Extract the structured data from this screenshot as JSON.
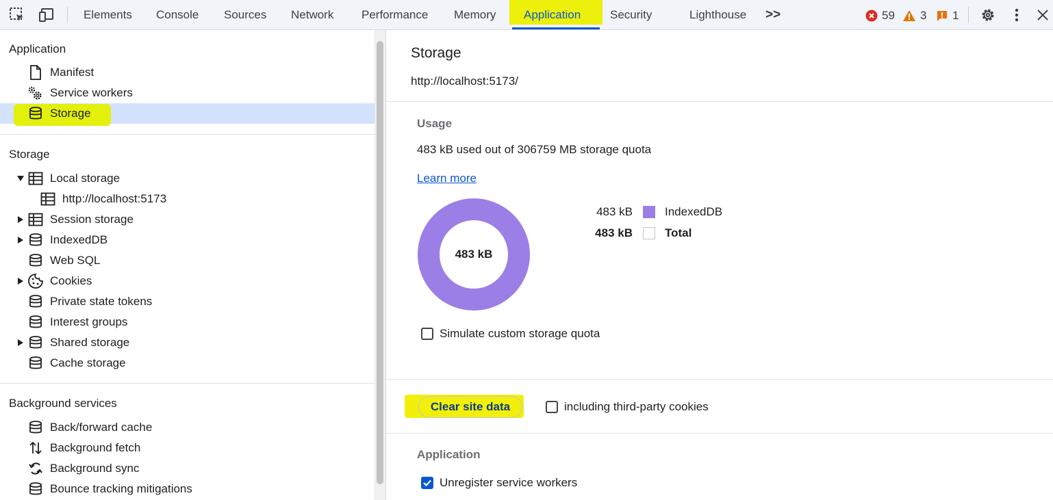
{
  "toolbar": {
    "tabs": [
      "Elements",
      "Console",
      "Sources",
      "Network",
      "Performance",
      "Memory",
      "Application",
      "Security",
      "Lighthouse"
    ],
    "active_tab": "Application",
    "more_tabs": ">>",
    "errors_count": "59",
    "warnings_count": "3",
    "issues_count": "1",
    "colors": {
      "active": "#0b57d0",
      "error": "#d93025",
      "warning": "#e37400",
      "issue": "#e8710a"
    }
  },
  "sidebar": {
    "application_header": "Application",
    "application_items": [
      {
        "label": "Manifest",
        "icon": "document-icon"
      },
      {
        "label": "Service workers",
        "icon": "gears-icon"
      },
      {
        "label": "Storage",
        "icon": "database-icon",
        "selected": true
      }
    ],
    "storage_header": "Storage",
    "storage_items": [
      {
        "label": "Local storage",
        "icon": "table-icon",
        "expanded": true
      },
      {
        "label": "http://localhost:5173",
        "icon": "table-icon"
      },
      {
        "label": "Session storage",
        "icon": "table-icon"
      },
      {
        "label": "IndexedDB",
        "icon": "database-icon"
      },
      {
        "label": "Web SQL",
        "icon": "database-icon"
      },
      {
        "label": "Cookies",
        "icon": "cookie-icon"
      },
      {
        "label": "Private state tokens",
        "icon": "database-icon"
      },
      {
        "label": "Interest groups",
        "icon": "database-icon"
      },
      {
        "label": "Shared storage",
        "icon": "database-icon"
      },
      {
        "label": "Cache storage",
        "icon": "database-icon"
      }
    ],
    "background_header": "Background services",
    "background_items": [
      {
        "label": "Back/forward cache",
        "icon": "database-icon"
      },
      {
        "label": "Background fetch",
        "icon": "arrows-updown-icon"
      },
      {
        "label": "Background sync",
        "icon": "sync-icon"
      },
      {
        "label": "Bounce tracking mitigations",
        "icon": "database-icon"
      }
    ]
  },
  "main": {
    "title": "Storage",
    "origin": "http://localhost:5173/",
    "usage_header": "Usage",
    "usage_text": "483 kB used out of 306759 MB storage quota",
    "learn_more": "Learn more",
    "donut_center": "483 kB",
    "legend": [
      {
        "value": "483 kB",
        "label": "IndexedDB",
        "color": "#9b7fe6"
      },
      {
        "value": "483 kB",
        "label": "Total",
        "color": "#ffffff"
      }
    ],
    "simulate_quota_label": "Simulate custom storage quota",
    "simulate_quota_checked": false,
    "clear_button": "Clear site data",
    "third_party_label": "including third-party cookies",
    "third_party_checked": false,
    "application_header": "Application",
    "unregister_label": "Unregister service workers",
    "unregister_checked": true
  }
}
